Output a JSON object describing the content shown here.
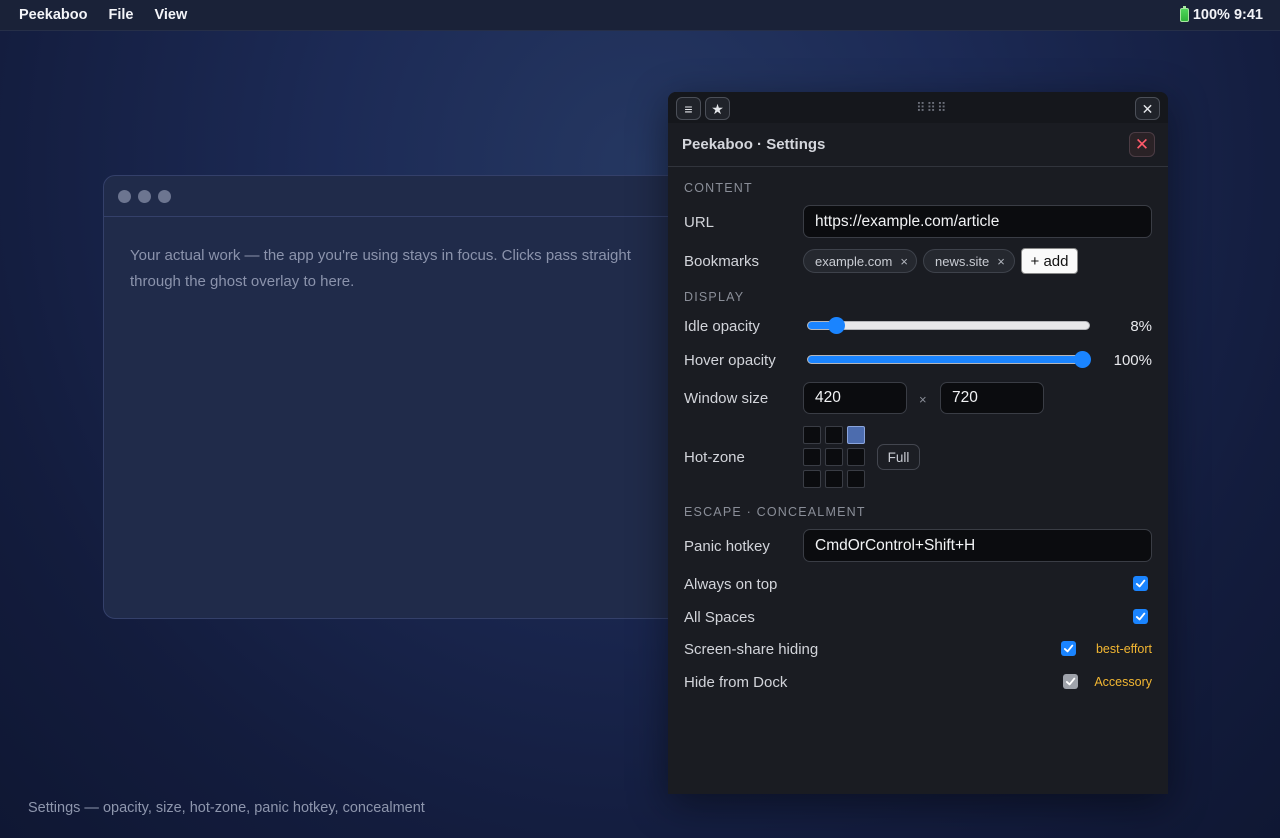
{
  "menubar": {
    "app_name": "Peekaboo",
    "items": [
      "File",
      "View"
    ],
    "status": "100% 9:41"
  },
  "work_window": {
    "body": "Your actual work — the app you're using stays in focus. Clicks pass straight through the ghost overlay to here."
  },
  "caption": "Settings — opacity, size, hot-zone, panic hotkey, concealment",
  "panel": {
    "toolbar": {
      "menu_glyph": "≡",
      "star_glyph": "★",
      "grip": "⠿⠿⠿",
      "close_glyph": "✕"
    },
    "title": "Peekaboo · Settings",
    "close_glyph": "✕",
    "content": {
      "heading": "CONTENT",
      "url_label": "URL",
      "url_value": "https://example.com/article",
      "bookmarks_label": "Bookmarks",
      "bookmarks": [
        "example.com",
        "news.site"
      ],
      "chip_remove": "×",
      "add_label": "+ add"
    },
    "display": {
      "heading": "DISPLAY",
      "idle_label": "Idle opacity",
      "idle_value": 8,
      "idle_text": "8%",
      "hover_label": "Hover opacity",
      "hover_value": 100,
      "hover_text": "100%",
      "size_label": "Window size",
      "width": "420",
      "height": "720",
      "times": "×",
      "hotzone_label": "Hot-zone",
      "hotzone_selected": "top-right",
      "full_label": "Full"
    },
    "escape": {
      "heading": "ESCAPE · CONCEALMENT",
      "panic_label": "Panic hotkey",
      "panic_value": "CmdOrControl+Shift+H",
      "always_on_top": "Always on top",
      "all_spaces": "All Spaces",
      "screen_share": "Screen-share hiding",
      "screen_share_note": "best-effort",
      "hide_dock": "Hide from Dock",
      "hide_dock_note": "Accessory"
    }
  },
  "colors": {
    "accent": "#1a84ff",
    "warning": "#f2b632",
    "danger": "#ff5a6a"
  }
}
